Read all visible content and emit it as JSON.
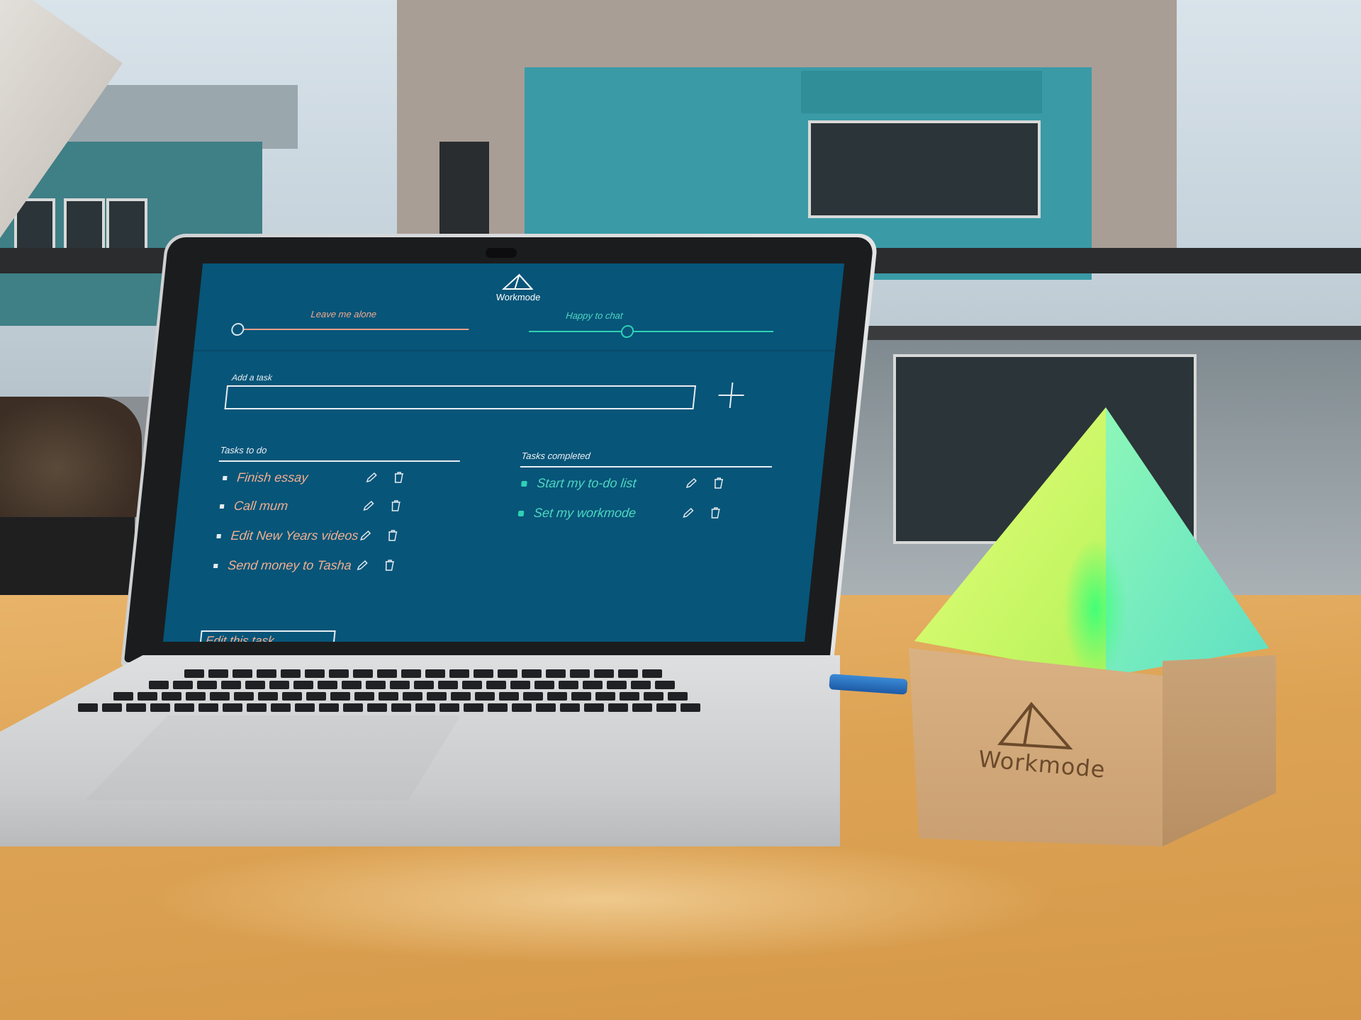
{
  "app": {
    "title": "Workmode",
    "status_slider": {
      "left_label": "Leave me alone",
      "right_label": "Happy to chat"
    },
    "add_task": {
      "label": "Add a task",
      "input_value": "",
      "add_button": "+"
    },
    "tasks_todo": {
      "title": "Tasks to do",
      "items": [
        {
          "label": "Finish essay"
        },
        {
          "label": "Call mum"
        },
        {
          "label": "Edit New Years videos"
        },
        {
          "label": "Send money to Tasha"
        }
      ],
      "editing_value": "Edit this task"
    },
    "tasks_completed": {
      "title": "Tasks completed",
      "items": [
        {
          "label": "Start my to-do list"
        },
        {
          "label": "Set my workmode"
        }
      ]
    }
  },
  "device": {
    "engraving": "Workmode"
  },
  "colors": {
    "screen_bg": "#075579",
    "todo_text": "#f2b08f",
    "done_text": "#4fd6c0",
    "slider_accent": "#2fd1b5",
    "device_glow": "#3cff78"
  },
  "icons": {
    "logo": "triangle-logo-icon",
    "edit": "pencil-icon",
    "delete": "trash-icon",
    "add": "plus-icon"
  }
}
